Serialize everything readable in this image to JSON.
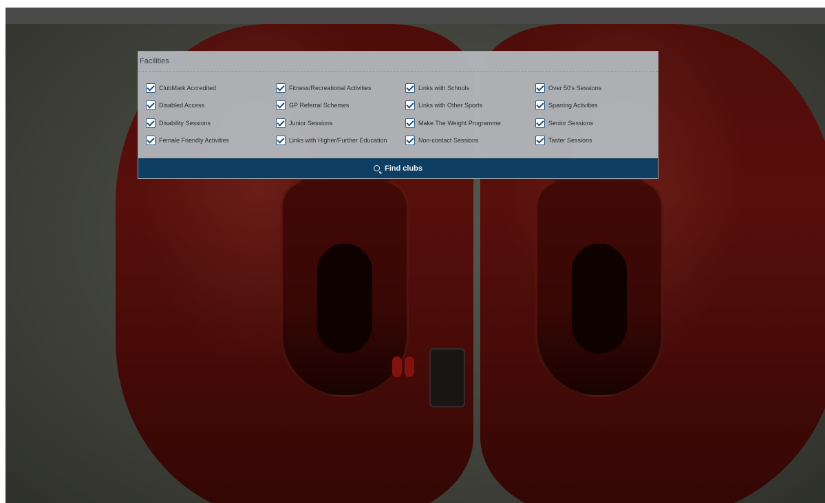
{
  "facilities": {
    "title": "Facilities",
    "columns": [
      [
        {
          "label": "ClubMark Accredited",
          "checked": true
        },
        {
          "label": "Disabled Access",
          "checked": true
        },
        {
          "label": "Disability Sessions",
          "checked": true
        },
        {
          "label": "Female Friendly Activities",
          "checked": true
        }
      ],
      [
        {
          "label": "Fitness/Recreational Activities",
          "checked": true
        },
        {
          "label": "GP Referral Schemes",
          "checked": true
        },
        {
          "label": "Junior Sessions",
          "checked": true
        },
        {
          "label": "Links with Higher/Further Education",
          "checked": true
        }
      ],
      [
        {
          "label": "Links with Schools",
          "checked": true
        },
        {
          "label": "Links with Other Sports",
          "checked": true
        },
        {
          "label": "Make The Weight Programme",
          "checked": true
        },
        {
          "label": "Non-contact Sessions",
          "checked": true
        }
      ],
      [
        {
          "label": "Over 50's Sessions",
          "checked": true
        },
        {
          "label": "Sparring Activities",
          "checked": true
        },
        {
          "label": "Senior Sessions",
          "checked": true
        },
        {
          "label": "Taster Sessions",
          "checked": true
        }
      ]
    ],
    "find_button": {
      "label": "Find clubs",
      "icon": "search-icon"
    }
  },
  "colors": {
    "button_bg": "#0f3e63",
    "checkbox_accent": "#1f4c79",
    "panel_bg": "#b2b6ba"
  }
}
